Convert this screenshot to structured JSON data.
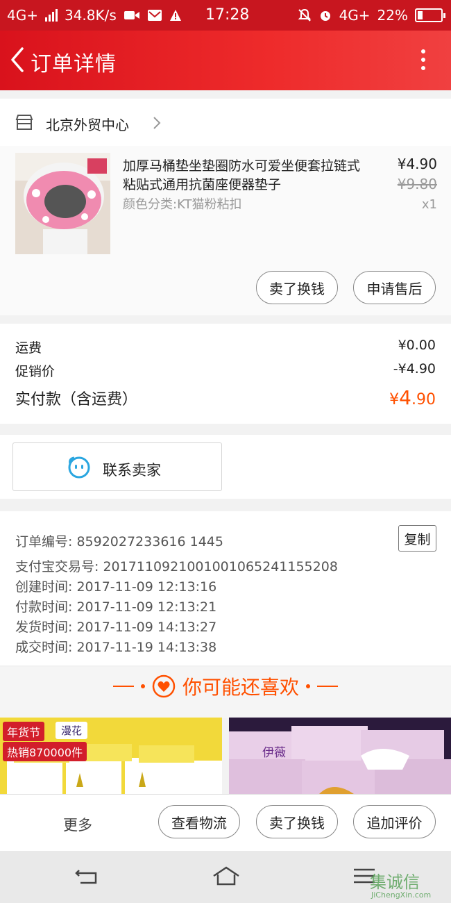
{
  "status_bar": {
    "network": "4G+",
    "speed": "34.8K/s",
    "time": "17:28",
    "network_right": "4G+",
    "battery": "22%",
    "battery_level": 0.22
  },
  "header": {
    "title": "订单详情"
  },
  "store": {
    "name": "北京外贸中心"
  },
  "item": {
    "title": "加厚马桶垫坐垫圈防水可爱坐便套拉链式粘贴式通用抗菌座便器垫子",
    "sku": "颜色分类:KT猫粉粘扣",
    "price": "¥4.90",
    "original_price": "¥9.80",
    "quantity": "x1",
    "buttons": {
      "resell": "卖了换钱",
      "after_sale": "申请售后"
    }
  },
  "fees": {
    "shipping_label": "运费",
    "shipping_value": "¥0.00",
    "promo_label": "促销价",
    "promo_value": "-¥4.90",
    "total_label": "实付款（含运费）",
    "total_currency": "¥",
    "total_int": "4",
    "total_dec": ".90"
  },
  "contact": {
    "label": "联系卖家"
  },
  "order_info": {
    "order_no": "订单编号: 8592027233616 1445",
    "alipay_no": "支付宝交易号: 2017110921001001065241155208",
    "created": "创建时间: 2017-11-09 12:13:16",
    "paid": "付款时间: 2017-11-09 12:13:21",
    "shipped": "发货时间: 2017-11-09 14:13:27",
    "completed": "成交时间: 2017-11-19 14:13:38",
    "copy_label": "复制"
  },
  "recommend": {
    "title": "你可能还喜欢",
    "left": {
      "banner": "年货节",
      "brand": "漫花",
      "hot": "热销870000件"
    },
    "right": {
      "brand": "伊薇"
    }
  },
  "bottom_bar": {
    "more": "更多",
    "logistics": "查看物流",
    "resell": "卖了换钱",
    "add_review": "追加评价"
  },
  "watermark": {
    "cn": "集诚信",
    "en": "JiChengXin.com"
  },
  "colors": {
    "brand_red": "#d9121c",
    "accent_orange": "#ff5000",
    "contact_blue": "#2aa6e0"
  }
}
